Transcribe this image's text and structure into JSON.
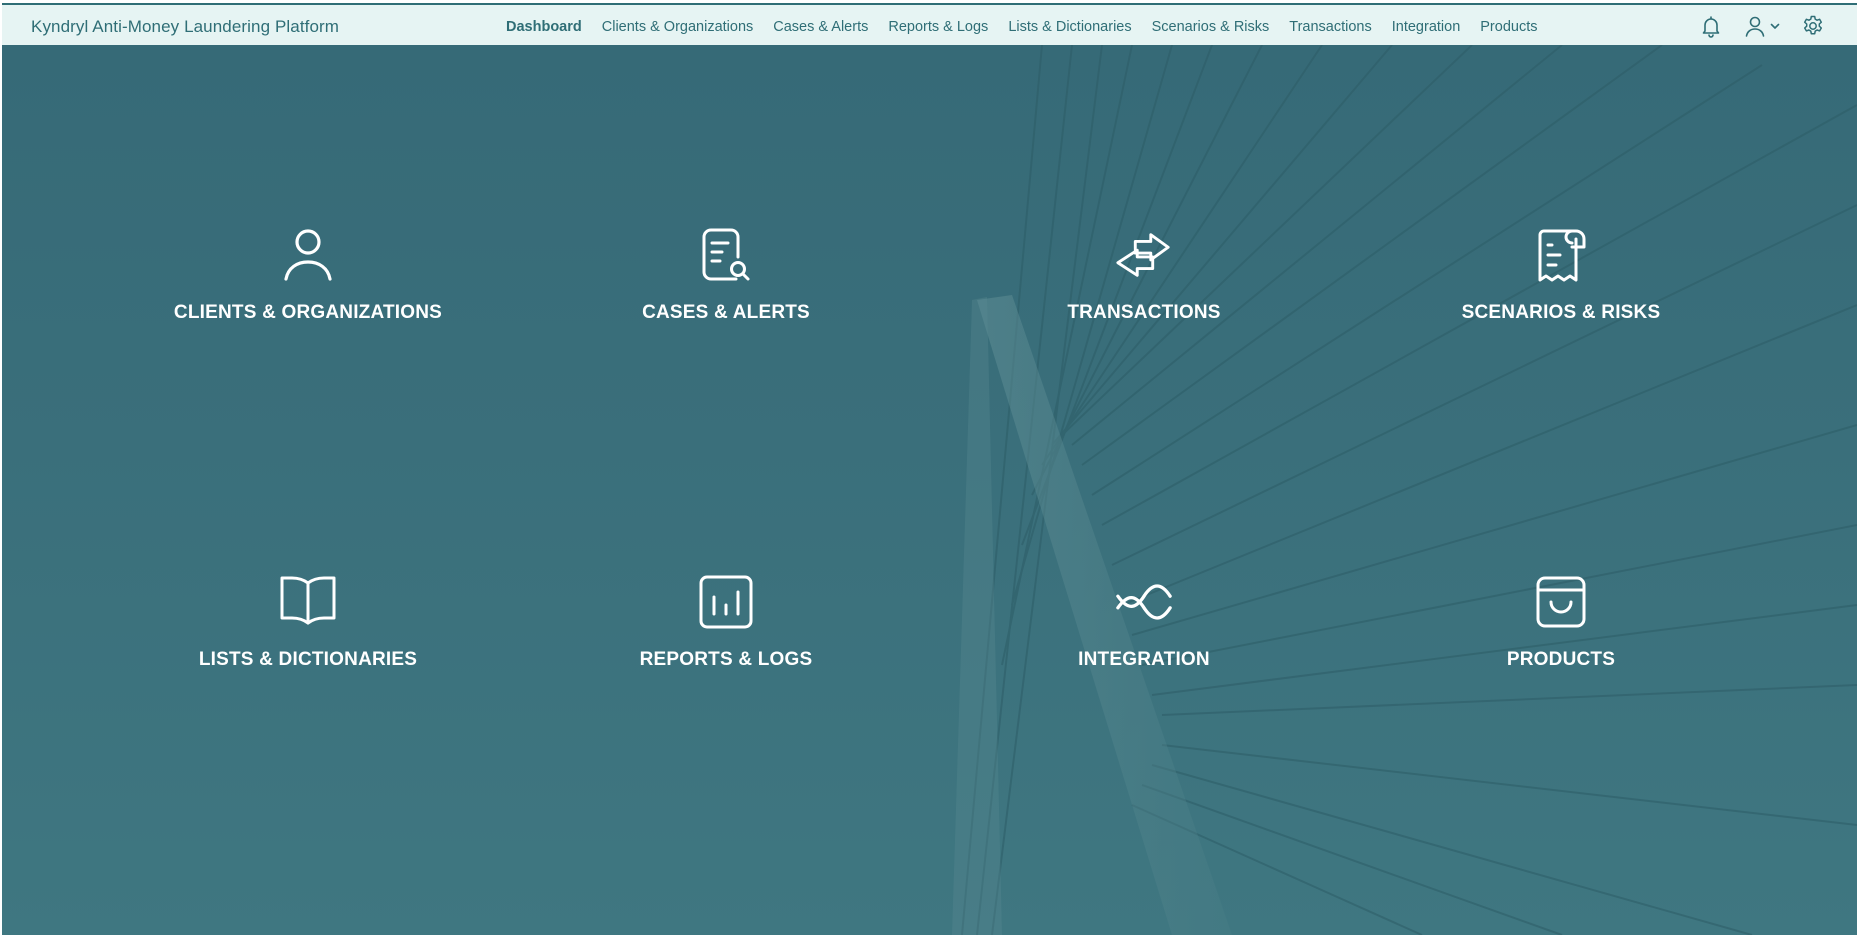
{
  "app": {
    "title": "Kyndryl Anti-Money Laundering Platform"
  },
  "nav": {
    "items": [
      {
        "label": "Dashboard",
        "active": true
      },
      {
        "label": "Clients & Organizations",
        "active": false
      },
      {
        "label": "Cases & Alerts",
        "active": false
      },
      {
        "label": "Reports & Logs",
        "active": false
      },
      {
        "label": "Lists & Dictionaries",
        "active": false
      },
      {
        "label": "Scenarios & Risks",
        "active": false
      },
      {
        "label": "Transactions",
        "active": false
      },
      {
        "label": "Integration",
        "active": false
      },
      {
        "label": "Products",
        "active": false
      }
    ]
  },
  "header_icons": [
    "bell-icon",
    "user-icon",
    "chevron-down-icon",
    "gear-icon"
  ],
  "tiles": [
    {
      "label": "CLIENTS & ORGANIZATIONS",
      "icon": "user-icon"
    },
    {
      "label": "CASES & ALERTS",
      "icon": "document-search-icon"
    },
    {
      "label": "TRANSACTIONS",
      "icon": "exchange-arrows-icon"
    },
    {
      "label": "SCENARIOS & RISKS",
      "icon": "scroll-icon"
    },
    {
      "label": "LISTS & DICTIONARIES",
      "icon": "open-book-icon"
    },
    {
      "label": "REPORTS & LOGS",
      "icon": "bar-chart-icon"
    },
    {
      "label": "INTEGRATION",
      "icon": "integration-waves-icon"
    },
    {
      "label": "PRODUCTS",
      "icon": "shopping-bag-icon"
    }
  ],
  "colors": {
    "accent": "#2f6e76",
    "topbar_bg": "#e6f4f3",
    "hero_bg": "#3a6f7b",
    "tile_text": "#ffffff"
  }
}
